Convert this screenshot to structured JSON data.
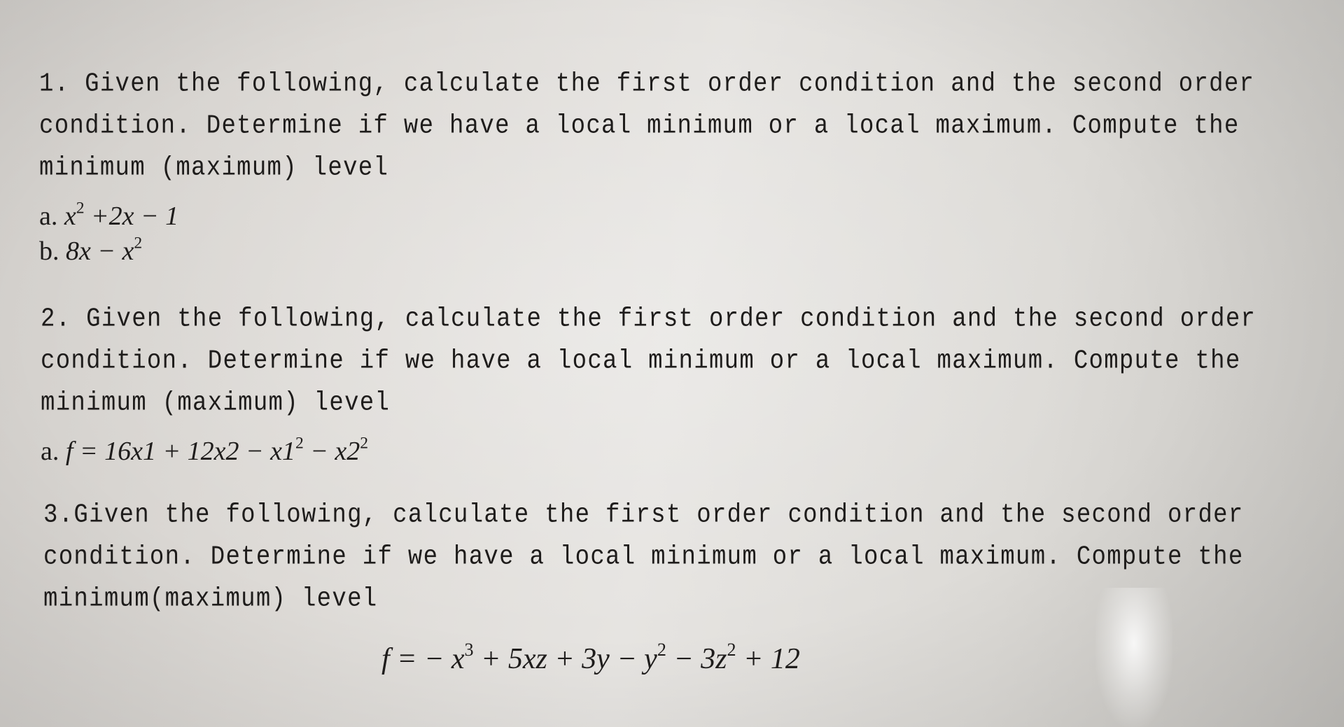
{
  "document": {
    "questions": [
      {
        "lines": [
          "1. Given the following, calculate the first order condition and the second order",
          "condition. Determine if we have a local minimum or a local maximum. Compute the",
          "minimum (maximum) level"
        ],
        "items": [
          {
            "label": "a.",
            "base1": "x",
            "exp1": "2",
            "rest": " +2x − 1"
          },
          {
            "label": "b.",
            "text": "8x − x",
            "exp": "2"
          }
        ]
      },
      {
        "lines": [
          "2. Given the following, calculate the first order condition and the second order",
          "condition. Determine if we have a local minimum or a local maximum. Compute the",
          "minimum (maximum) level"
        ],
        "items": [
          {
            "label": "a.",
            "f": "f",
            "p1": " = 16x1 + 12x2 − x1",
            "e1": "2",
            "p2": " − x2",
            "e2": "2"
          }
        ]
      },
      {
        "lines": [
          "3.Given the following, calculate the first order condition and the second order",
          "condition. Determine if we have a local minimum or a local maximum. Compute the",
          "minimum(maximum) level"
        ],
        "formula": {
          "f": "f",
          "p1": " = − x",
          "e1": "3",
          "p2": " + 5xz + 3y − y",
          "e2": "2",
          "p3": " − 3z",
          "e3": "2",
          "p4": " + 12"
        }
      }
    ]
  }
}
